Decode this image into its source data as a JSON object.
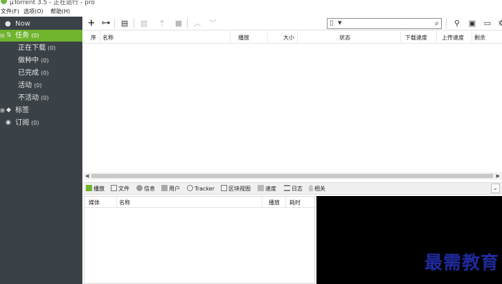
{
  "window": {
    "title": "μTorrent 3.5 - 正在运行 - pro"
  },
  "menu": [
    "文件(F)",
    "选项(O)",
    "帮助(H)"
  ],
  "sidebar": {
    "items": [
      {
        "label": "Now",
        "count": ""
      },
      {
        "label": "任务",
        "count": "(0)"
      },
      {
        "label": "正在下载",
        "count": "(0)"
      },
      {
        "label": "做种中",
        "count": "(0)"
      },
      {
        "label": "已完成",
        "count": "(0)"
      },
      {
        "label": "活动",
        "count": "(0)"
      },
      {
        "label": "不活动",
        "count": "(0)"
      },
      {
        "label": "标签",
        "count": ""
      },
      {
        "label": "订阅",
        "count": "(0)"
      }
    ]
  },
  "search": {
    "placeholder": ""
  },
  "torrent_columns": [
    "序",
    "名称",
    "播放",
    "大小",
    "状态",
    "下载速度",
    "上传速度",
    "剩余"
  ],
  "detail_tabs": [
    "播放",
    "文件",
    "信息",
    "用户",
    "Tracker",
    "区块视图",
    "速度",
    "日志",
    "相关"
  ],
  "peers_columns": [
    "媒体",
    "名称",
    "播放",
    "耗时"
  ],
  "watermark": "最需教育",
  "colors": {
    "sidebar_bg": "#3b4247",
    "sidebar_active": "#6fb42c",
    "watermark": "#1f2a9e"
  }
}
